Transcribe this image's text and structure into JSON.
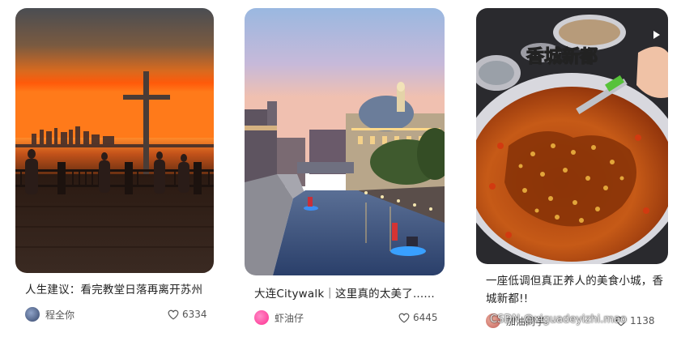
{
  "cards": [
    {
      "title": "人生建议：看完教堂日落再离开苏州",
      "author": "程全你",
      "likes": "6334",
      "image": "sunset-cross-lake-photo"
    },
    {
      "title": "大连Citywalk｜这里真的太美了......",
      "author": "虾油仔",
      "likes": "6445",
      "image": "canal-dome-evening-photo"
    },
    {
      "title_line1": "一座低调但真正养人的美食小城，香",
      "title_line2": "城新都!!",
      "image_overlay_text": "香城新都",
      "author": "加油同学",
      "likes": "1138",
      "image": "spicy-food-platter-photo"
    }
  ],
  "watermark": "CSDN @xiguadeyizhi.mao",
  "colors": {
    "sunset_orange": "#ff6a10",
    "text_primary": "#222222",
    "text_secondary": "#555555",
    "avatar2": "#ff4fa3"
  }
}
